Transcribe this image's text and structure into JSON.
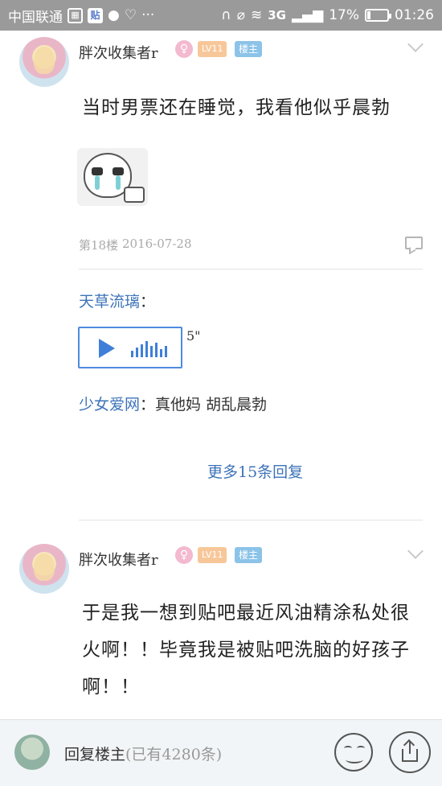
{
  "status_bar": {
    "carrier": "中国联通",
    "network": "3G",
    "battery_percent_text": "17%",
    "battery_level": 0.17,
    "time": "01:26",
    "icons": [
      "gallery-icon",
      "tieba-icon",
      "coin-icon",
      "shield-icon",
      "more-dots-icon",
      "headphones-icon",
      "mute-icon",
      "wifi-icon",
      "signal-icon",
      "battery-icon"
    ]
  },
  "posts": [
    {
      "username": "胖次收集者r",
      "gender_symbol": "♀",
      "level": "LV11",
      "badge": "楼主",
      "content": "当时男票还在睡觉，我看他似乎晨勃",
      "has_sticker": true,
      "floor": "第18楼",
      "date": "2016-07-28",
      "replies": [
        {
          "name": "天草流璃",
          "separator": "：",
          "type": "voice",
          "duration": "5\""
        },
        {
          "name": "少女爱网",
          "separator": "：",
          "text": "真他妈 胡乱晨勃"
        }
      ],
      "more_replies": "更多15条回复"
    },
    {
      "username": "胖次收集者r",
      "gender_symbol": "♀",
      "level": "LV11",
      "badge": "楼主",
      "content_lines": [
        "于是我一想到贴吧最近风油精涂私处很",
        "火啊！！毕竟我是被贴吧洗脑的好孩子",
        "啊！！"
      ]
    }
  ],
  "bottom_bar": {
    "reply_label": "回复楼主",
    "count_text": "(已有4280条)"
  },
  "colors": {
    "link": "#3d73b8",
    "voice_accent": "#3f7fd8",
    "level_badge": "#f7c79a",
    "host_badge": "#8cc3e8",
    "gender_badge": "#f3b9cf"
  }
}
